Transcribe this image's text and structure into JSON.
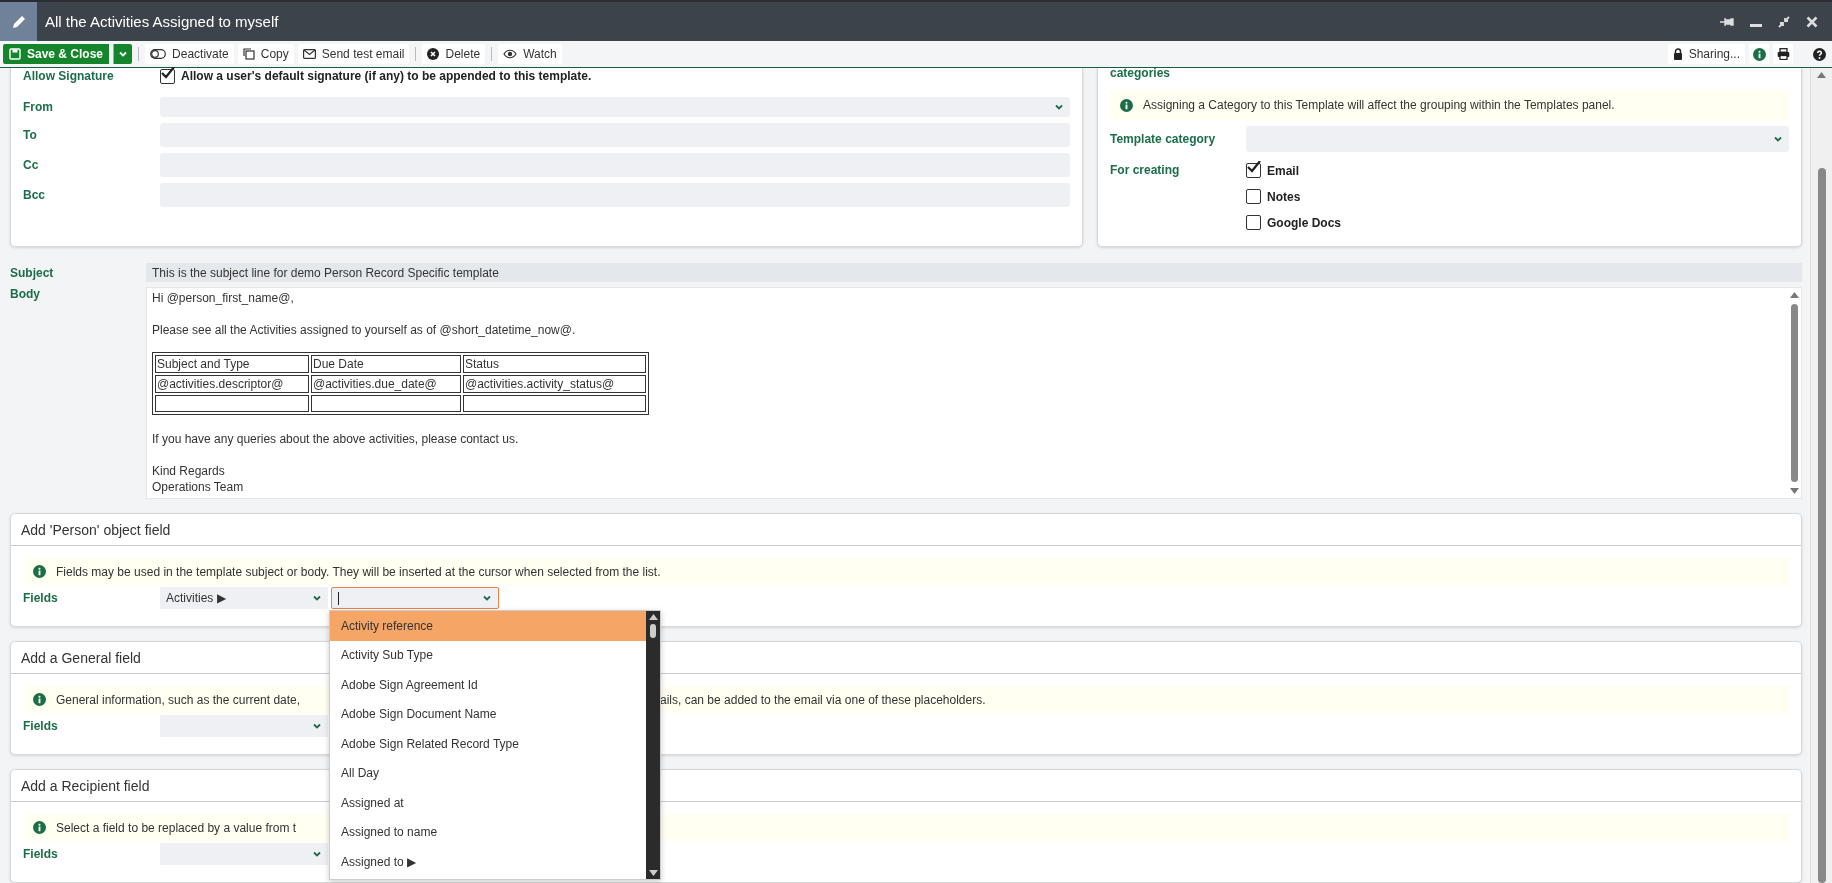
{
  "window": {
    "title": "All the Activities Assigned to myself"
  },
  "toolbar": {
    "items": [
      {
        "label": "Save & Close",
        "kind": "primary"
      },
      {
        "label": "Deactivate",
        "kind": "plain"
      },
      {
        "label": "Copy",
        "kind": "plain"
      },
      {
        "label": "Send test email",
        "kind": "plain"
      },
      {
        "label": "Delete",
        "kind": "plain"
      },
      {
        "label": "Watch",
        "kind": "plain"
      }
    ],
    "sharing": "Sharing..."
  },
  "email_card": {
    "allow_signature": {
      "label": "Allow Signature",
      "text": "Allow a user's default signature (if any) to be appended to this template.",
      "checked": true
    },
    "fields": [
      {
        "label": "From",
        "kind": "select"
      },
      {
        "label": "To",
        "kind": "text"
      },
      {
        "label": "Cc",
        "kind": "text"
      },
      {
        "label": "Bcc",
        "kind": "text"
      }
    ]
  },
  "category_card": {
    "cut_label": "categories",
    "info": "Assigning a Category to this Template will affect the grouping within the Templates panel.",
    "template_category": "Template category",
    "for_creating": {
      "label": "For creating",
      "options": [
        {
          "label": "Email",
          "checked": true
        },
        {
          "label": "Notes",
          "checked": false
        },
        {
          "label": "Google Docs",
          "checked": false
        }
      ]
    }
  },
  "subject": {
    "label": "Subject",
    "value": "This is the subject line for demo Person Record Specific template"
  },
  "body": {
    "label": "Body",
    "greeting": "Hi @person_first_name@,",
    "intro": "Please see all the Activities assigned to yourself as of @short_datetime_now@.",
    "table": {
      "columns": [
        "Subject and Type",
        "Due Date",
        "Status"
      ],
      "rows": [
        [
          "@activities.descriptor@",
          "@activities.due_date@",
          "@activities.activity_status@"
        ],
        [
          null,
          null,
          null
        ]
      ]
    },
    "closing": "If you have any queries about the above activities, please contact us.",
    "signoff": [
      "Kind Regards",
      "Operations Team"
    ]
  },
  "sections": [
    {
      "title": "Add 'Person' object field",
      "info": [
        "Fields may be used in the template subject or body. They will be inserted at the cursor when selected from the list."
      ],
      "fields_label": "Fields",
      "selects": [
        {
          "value": "Activities ▶",
          "focused": false
        },
        {
          "focused": true
        }
      ]
    },
    {
      "title": "Add a General field",
      "info": [
        "General information, such as the current date,",
        "ails, can be added to the email via one of these placeholders."
      ],
      "fields_label": "Fields",
      "selects": [
        {
          "focused": false
        }
      ]
    },
    {
      "title": "Add a Recipient field",
      "info": [
        "Select a field to be replaced by a value from t"
      ],
      "fields_label": "Fields",
      "selects": [
        {
          "focused": false
        }
      ]
    }
  ],
  "dropdown": {
    "items": [
      {
        "label": "Activity reference",
        "selected": true
      },
      {
        "label": "Activity Sub Type",
        "selected": false
      },
      {
        "label": "Adobe Sign Agreement Id",
        "selected": false
      },
      {
        "label": "Adobe Sign Document Name",
        "selected": false
      },
      {
        "label": "Adobe Sign Related Record Type",
        "selected": false
      },
      {
        "label": "All Day",
        "selected": false
      },
      {
        "label": "Assigned at",
        "selected": false
      },
      {
        "label": "Assigned to name",
        "selected": false
      },
      {
        "label": "Assigned to ▶",
        "selected": false
      }
    ]
  }
}
